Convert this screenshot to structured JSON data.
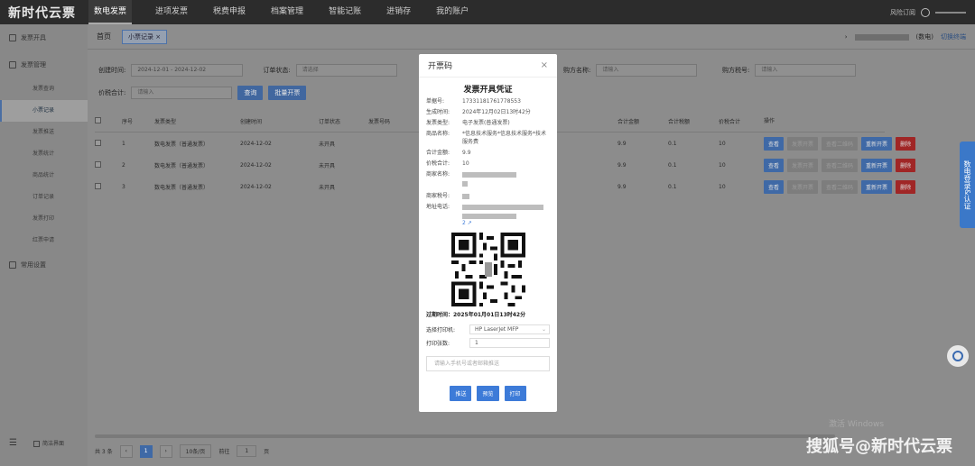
{
  "app": {
    "logo": "新时代云票"
  },
  "nav": {
    "items": [
      "数电发票",
      "进项发票",
      "税费申报",
      "档案管理",
      "智能记账",
      "进销存",
      "我的账户"
    ],
    "right_text": "风险订阅"
  },
  "sidebar": {
    "groups": [
      {
        "label": "发票开具"
      },
      {
        "label": "发票管理"
      }
    ],
    "sub_items": [
      "发票查询",
      "小票记录",
      "发票推送",
      "发票统计",
      "商品统计",
      "订单记录",
      "发票打印",
      "红票申请"
    ],
    "settings": "常用设置",
    "bottom_label": "简洁界面"
  },
  "tabbar": {
    "crumb": "首页",
    "tab": "小票记录",
    "tab_close": "×",
    "right_label": "(数电)",
    "switch_label": "切换终端"
  },
  "filters": {
    "created_label": "创建时间:",
    "date_range": "2024-12-01 - 2024-12-02",
    "order_status_label": "订单状态:",
    "order_status_placeholder": "请选择",
    "buyer_name_label": "购方名称:",
    "buyer_name_placeholder": "请输入",
    "buyer_tax_label": "购方税号:",
    "buyer_tax_placeholder": "请输入",
    "tax_total_label": "价税合计:",
    "tax_total_placeholder": "请输入",
    "query_btn": "查询",
    "batch_btn": "批量开票"
  },
  "table": {
    "headers": [
      "序号",
      "发票类型",
      "创建时间",
      "订单状态",
      "发票号码",
      "合计金额",
      "合计税额",
      "价税合计",
      "操作"
    ],
    "rows": [
      {
        "no": "1",
        "type": "数电发票（普通发票）",
        "time": "2024-12-02",
        "status": "未开具",
        "amount": "9.9",
        "tax": "0.1",
        "total": "10"
      },
      {
        "no": "2",
        "type": "数电发票（普通发票）",
        "time": "2024-12-02",
        "status": "未开具",
        "amount": "9.9",
        "tax": "0.1",
        "total": "10"
      },
      {
        "no": "3",
        "type": "数电发票（普通发票）",
        "time": "2024-12-02",
        "status": "未开具",
        "amount": "9.9",
        "tax": "0.1",
        "total": "10"
      }
    ],
    "ops": [
      "查看",
      "发票开票",
      "查看二维码",
      "重新开票",
      "删除"
    ]
  },
  "pager": {
    "total": "共 3 条",
    "prev": "‹",
    "page": "1",
    "next": "›",
    "per_page": "10条/页",
    "goto": "前往",
    "goto_page": "1",
    "page_unit": "页"
  },
  "modal": {
    "title": "开票码",
    "close": "×",
    "doc_title": "发票开具凭证",
    "fields": [
      {
        "k": "单据号:",
        "v": "17331181761778553"
      },
      {
        "k": "生成时间:",
        "v": "2024年12月02日13时42分"
      },
      {
        "k": "发票类型:",
        "v": "电子发票(普通发票)"
      },
      {
        "k": "商品名称:",
        "v": "*信息技术服务*信息技术服务*技术服务费"
      },
      {
        "k": "合计金额:",
        "v": "9.9"
      },
      {
        "k": "价税合计:",
        "v": "10"
      }
    ],
    "merchant_name_label": "商家名称:",
    "merchant_tax_label": "商家税号:",
    "address_label": "地址电话:",
    "address_tail": "2",
    "expire": "过期时间：2025年01月01日13时42分",
    "printer_label": "选择打印机:",
    "printer_value": "HP LaserJet MFP",
    "copies_label": "打印张数:",
    "copies_value": "1",
    "phone_placeholder": "请输入手机号或者邮箱推送",
    "actions": [
      "推送",
      "预览",
      "打印"
    ]
  },
  "side_tab": "数电登录&认证",
  "activate_text": "激活 Windows",
  "watermark": "搜狐号@新时代云票"
}
